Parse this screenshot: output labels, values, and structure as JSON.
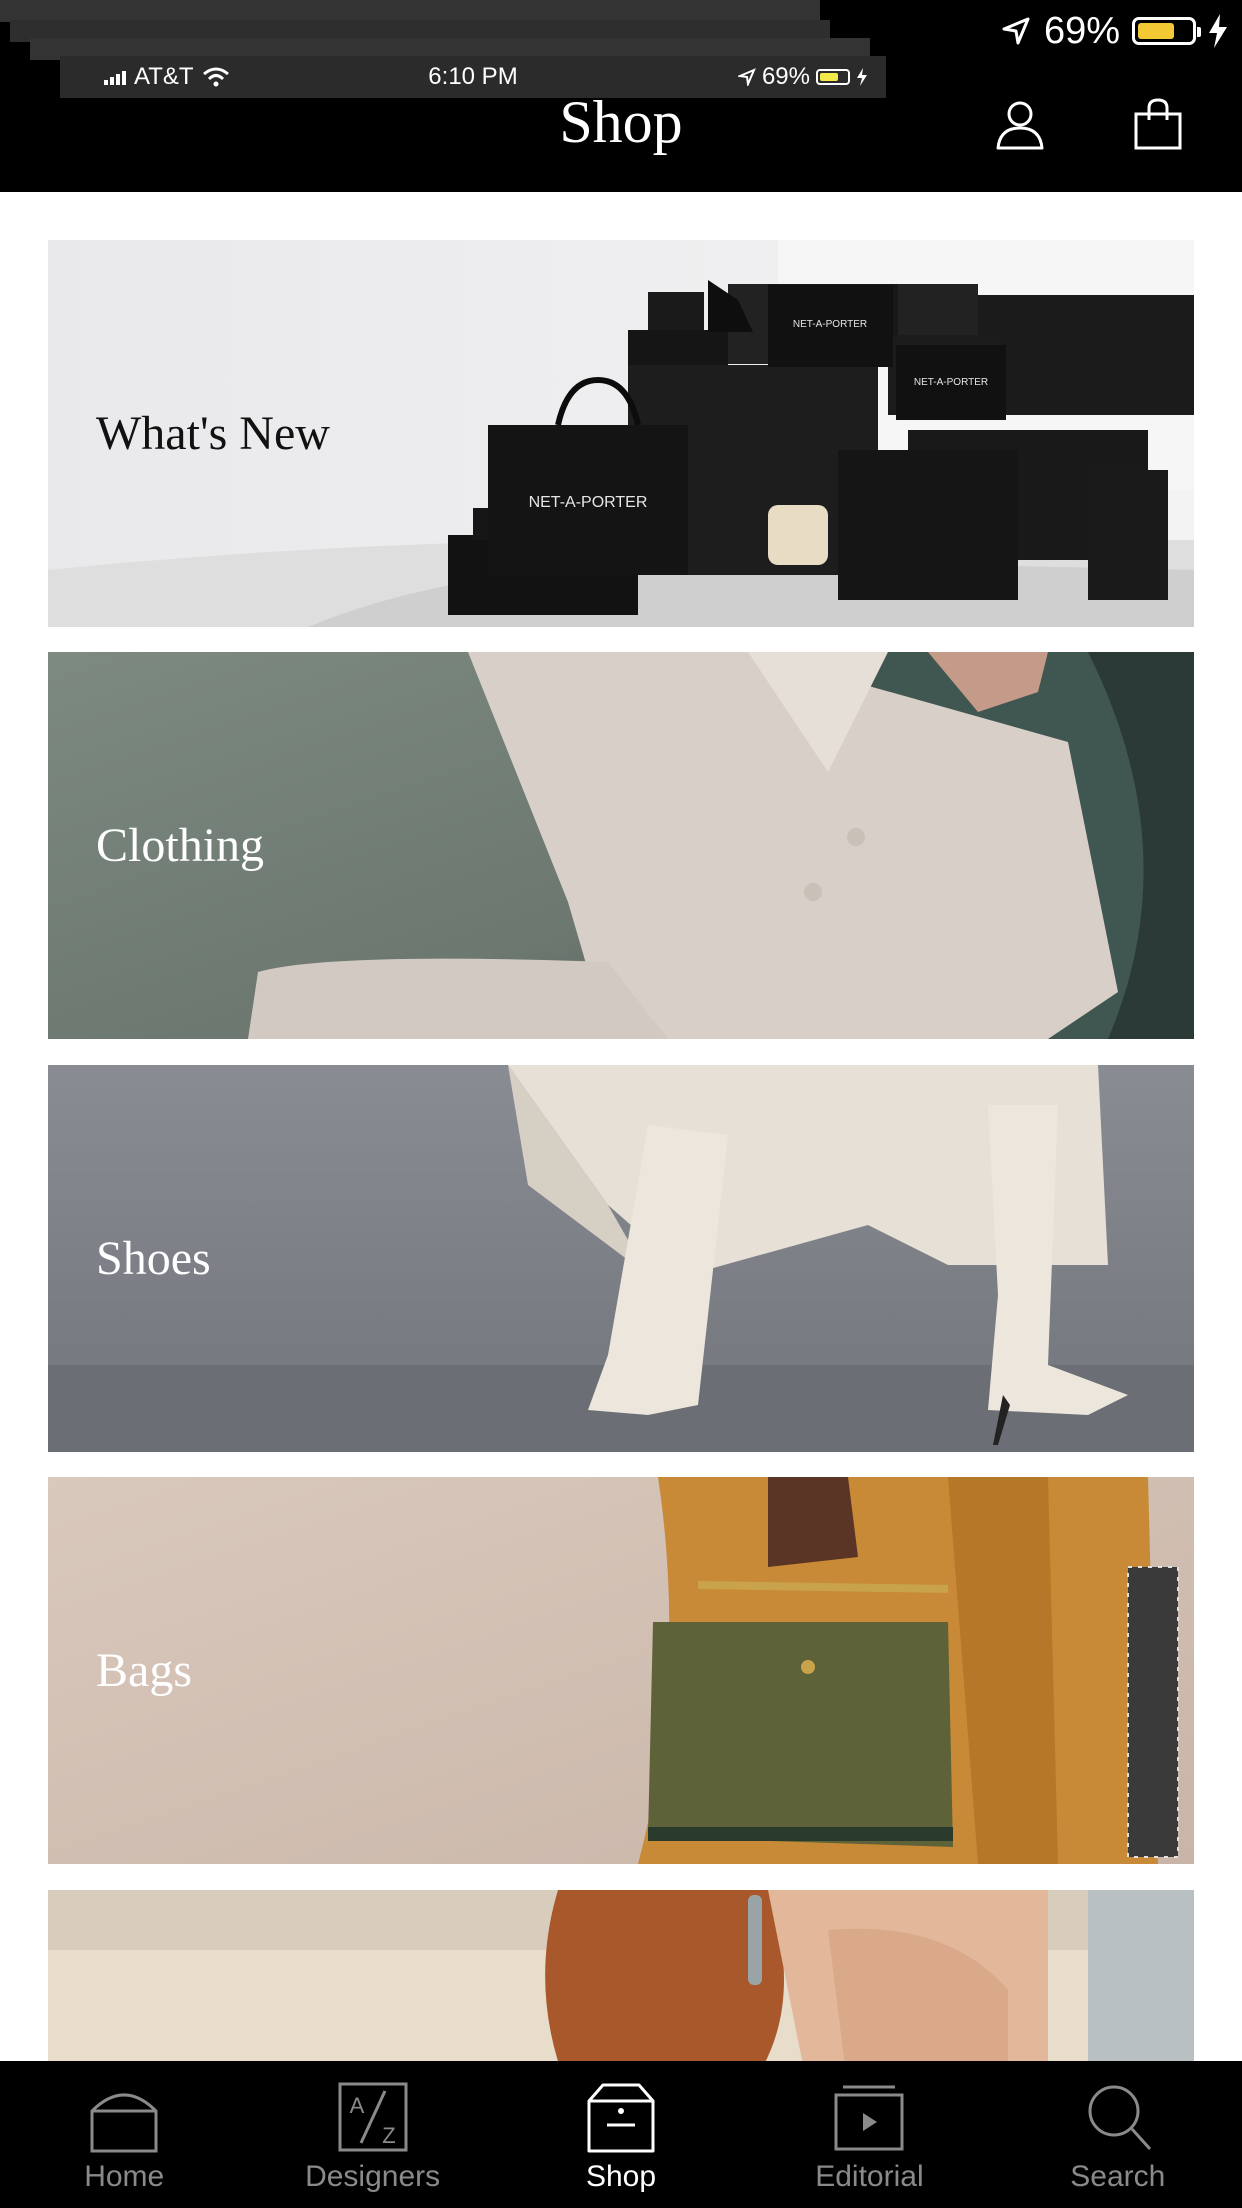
{
  "status_bar": {
    "carrier": "AT&T",
    "time": "6:10 PM",
    "battery": "69%",
    "battery_level": 0.69
  },
  "header": {
    "title": "Shop",
    "account_icon": "person-icon",
    "bag_icon": "shopping-bag-icon"
  },
  "categories": [
    {
      "label": "What's New"
    },
    {
      "label": "Clothing"
    },
    {
      "label": "Shoes"
    },
    {
      "label": "Bags"
    },
    {
      "label": ""
    }
  ],
  "image_text": {
    "bag_brand": "NET-A-PORTER"
  },
  "tab_bar": {
    "tabs": [
      {
        "label": "Home",
        "icon": "home-icon",
        "active": false
      },
      {
        "label": "Designers",
        "icon": "az-icon",
        "active": false
      },
      {
        "label": "Shop",
        "icon": "shop-bag-icon",
        "active": true
      },
      {
        "label": "Editorial",
        "icon": "play-icon",
        "active": false
      },
      {
        "label": "Search",
        "icon": "search-icon",
        "active": false
      }
    ]
  },
  "colors": {
    "bar": "#000000",
    "accent_battery": "#f2c935",
    "tab_active": "#ffffff",
    "tab_inactive": "#8a8a8a"
  }
}
